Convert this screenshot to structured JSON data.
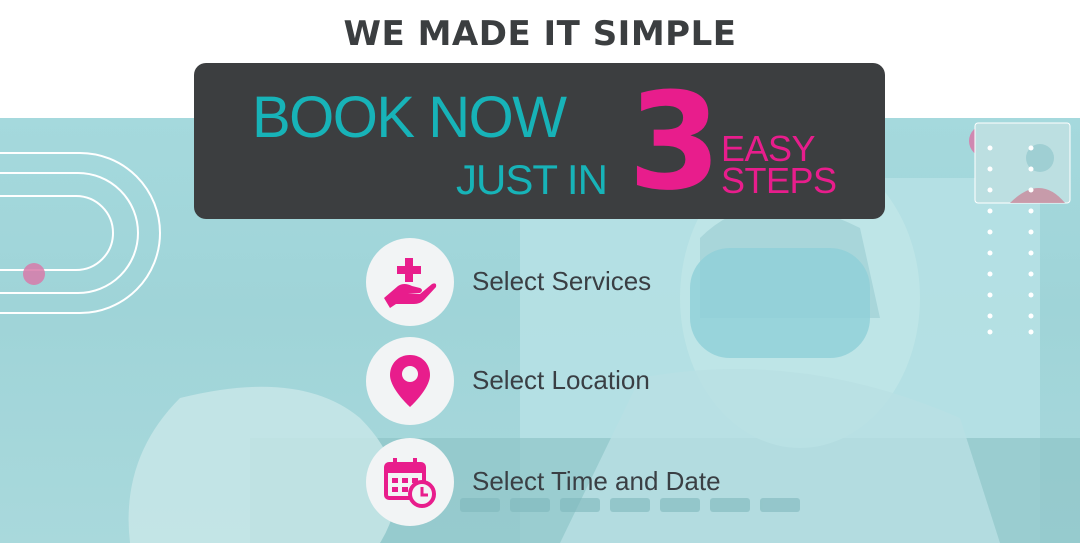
{
  "header": {
    "title": "WE MADE IT SIMPLE"
  },
  "headline": {
    "line1": "BOOK NOW",
    "line2": "JUST IN",
    "number": "3",
    "word1": "EASY",
    "word2": "STEPS"
  },
  "steps": [
    {
      "label": "Select Services",
      "icon": "hand-plus-icon"
    },
    {
      "label": "Select Location",
      "icon": "location-pin-icon"
    },
    {
      "label": "Select Time and Date",
      "icon": "calendar-clock-icon"
    }
  ],
  "colors": {
    "teal": "#17b3b8",
    "pink": "#e81d8c",
    "dark": "#3c3e40",
    "background": "#a5d9dd"
  }
}
